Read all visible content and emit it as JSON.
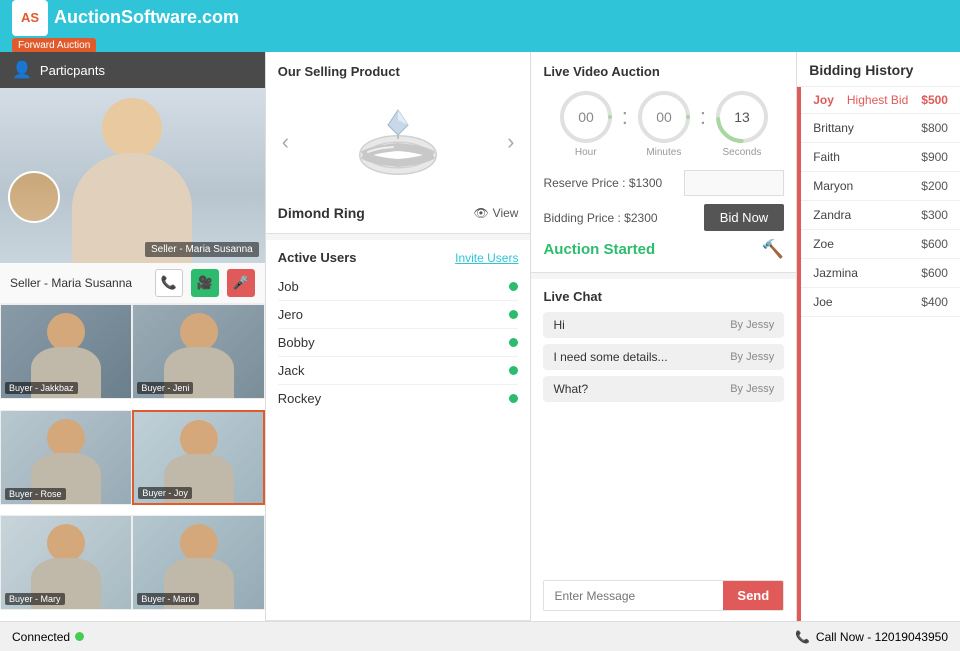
{
  "header": {
    "logo_text": "AuctionSoftware.com",
    "logo_initials": "AS",
    "badge": "Forward Auction"
  },
  "left_panel": {
    "participants_label": "Particpants",
    "seller_name": "Seller - Maria Susanna",
    "buyers": [
      {
        "label": "Buyer - Jakkbaz",
        "bg": 1
      },
      {
        "label": "Buyer - Jeni",
        "bg": 2
      },
      {
        "label": "Buyer - Rose",
        "bg": 3
      },
      {
        "label": "Buyer - Joy",
        "bg": 4,
        "highlighted": true
      },
      {
        "label": "Buyer - Mary",
        "bg": 5
      },
      {
        "label": "Buyer - Mario",
        "bg": 6
      }
    ]
  },
  "status_bar": {
    "connected_label": "Connected",
    "call_label": "Call Now - 12019043950"
  },
  "product_section": {
    "title": "Our Selling Product",
    "product_name": "Dimond Ring",
    "view_label": "View"
  },
  "active_users": {
    "title": "Active Users",
    "invite_label": "Invite Users",
    "users": [
      {
        "name": "Job",
        "online": true
      },
      {
        "name": "Jero",
        "online": true
      },
      {
        "name": "Bobby",
        "online": true
      },
      {
        "name": "Jack",
        "online": true
      },
      {
        "name": "Rockey",
        "online": true
      }
    ]
  },
  "video_auction": {
    "title": "Live Video Auction",
    "timer": {
      "hours": "00",
      "minutes": "00",
      "seconds": "13"
    },
    "hours_label": "Hour",
    "minutes_label": "Minutes",
    "seconds_label": "Seconds",
    "reserve_price_label": "Reserve Price : $1300",
    "bidding_price_label": "Bidding Price : $2300",
    "bid_now_label": "Bid Now",
    "auction_started_label": "Auction Started"
  },
  "live_chat": {
    "title": "Live Chat",
    "messages": [
      {
        "text": "Hi",
        "by": "By Jessy"
      },
      {
        "text": "I need some details...",
        "by": "By Jessy"
      },
      {
        "text": "What?",
        "by": "By Jessy"
      }
    ],
    "placeholder": "Enter Message",
    "send_label": "Send"
  },
  "bidding_history": {
    "title": "Bidding History",
    "top_row": {
      "name": "Joy",
      "label": "Highest Bid",
      "amount": "$500"
    },
    "bids": [
      {
        "name": "Brittany",
        "amount": "$800"
      },
      {
        "name": "Faith",
        "amount": "$900"
      },
      {
        "name": "Maryon",
        "amount": "$200"
      },
      {
        "name": "Zandra",
        "amount": "$300"
      },
      {
        "name": "Zoe",
        "amount": "$600"
      },
      {
        "name": "Jazmina",
        "amount": "$600"
      },
      {
        "name": "Joe",
        "amount": "$400"
      }
    ]
  }
}
